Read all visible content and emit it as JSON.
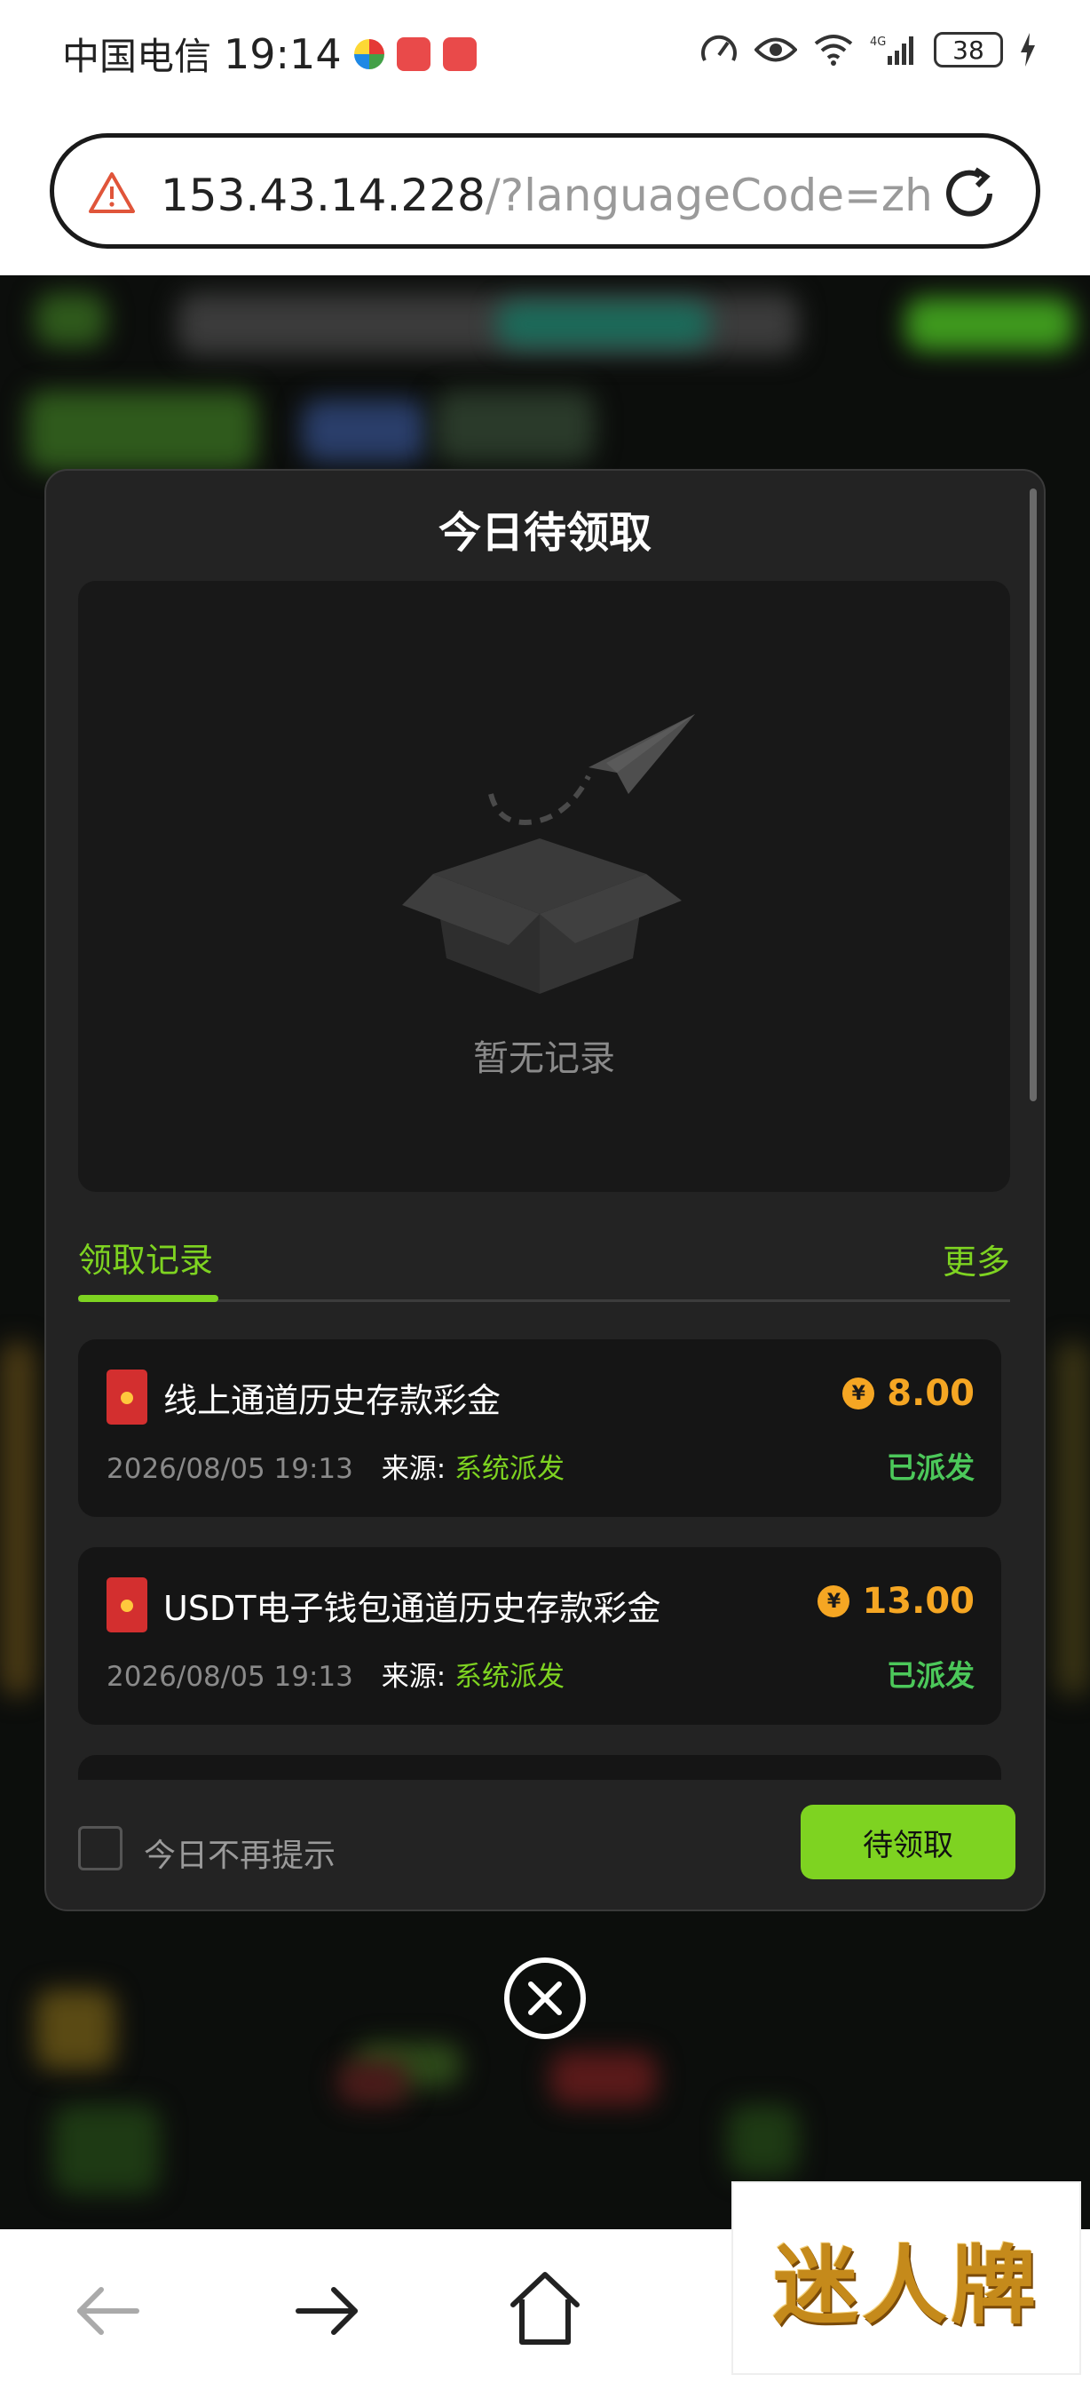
{
  "status_bar": {
    "carrier": "中国电信",
    "time": "19:14",
    "battery": "38"
  },
  "url_bar": {
    "host": "153.43.14.228",
    "path": "/?languageCode=zh"
  },
  "modal": {
    "title": "今日待领取",
    "empty_text": "暂无记录",
    "tab_records": "领取记录",
    "tab_more": "更多",
    "records": [
      {
        "title": "线上通道历史存款彩金",
        "amount": "8.00",
        "date": "2026/08/05 19:13",
        "source_label": "来源:",
        "source": "系统派发",
        "status": "已派发"
      },
      {
        "title": "USDT电子钱包通道历史存款彩金",
        "amount": "13.00",
        "date": "2026/08/05 19:13",
        "source_label": "来源:",
        "source": "系统派发",
        "status": "已派发"
      }
    ],
    "dont_show_today": "今日不再提示",
    "claim_button": "待领取",
    "coin_symbol": "¥"
  },
  "watermark": {
    "text": "迷人牌"
  },
  "colors": {
    "accent_green": "#7ed321",
    "amount_orange": "#f5a623",
    "modal_bg": "#232323",
    "page_bg": "#0c0e0c"
  }
}
